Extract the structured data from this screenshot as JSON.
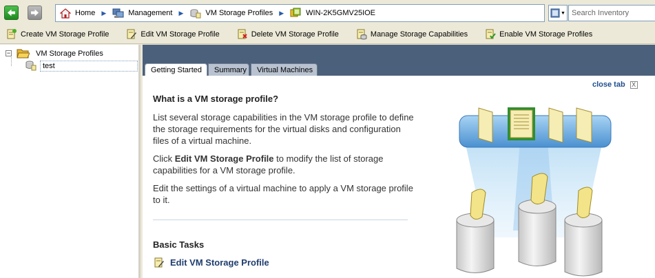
{
  "nav": {
    "breadcrumb": [
      {
        "label": "Home",
        "icon": "home-icon"
      },
      {
        "label": "Management",
        "icon": "management-icon"
      },
      {
        "label": "VM Storage Profiles",
        "icon": "storage-profiles-icon"
      },
      {
        "label": "WIN-2K5GMV25IOE",
        "icon": "vcenter-server-icon"
      }
    ],
    "search_placeholder": "Search Inventory"
  },
  "toolbar": {
    "items": [
      {
        "label": "Create VM Storage Profile",
        "icon": "create-profile-icon"
      },
      {
        "label": "Edit VM Storage Profile",
        "icon": "edit-profile-icon"
      },
      {
        "label": "Delete VM Storage Profile",
        "icon": "delete-profile-icon"
      },
      {
        "label": "Manage Storage Capabilities",
        "icon": "manage-capabilities-icon"
      },
      {
        "label": "Enable VM Storage Profiles",
        "icon": "enable-profiles-icon"
      }
    ]
  },
  "tree": {
    "root_label": "VM Storage Profiles",
    "expander": "−",
    "child_label": "test"
  },
  "tabs": [
    "Getting Started",
    "Summary",
    "Virtual Machines"
  ],
  "close_tab": {
    "label": "close tab",
    "x": "X"
  },
  "content": {
    "title": "What is a VM storage profile?",
    "para1": "List several storage capabilities in the VM storage profile to define the storage requirements for the virtual disks and configuration files of a virtual machine.",
    "para2_prefix": "Click ",
    "para2_bold": "Edit VM Storage Profile",
    "para2_suffix": " to modify the list of storage capabilities for a VM storage profile.",
    "para3": "Edit the settings of a virtual machine to apply a VM storage profile to it.",
    "basic_tasks_title": "Basic Tasks",
    "task_edit": "Edit VM Storage Profile"
  },
  "colors": {
    "tab_strip": "#4b607a",
    "link": "#1f3d6e",
    "window_bg": "#ece9d8"
  }
}
